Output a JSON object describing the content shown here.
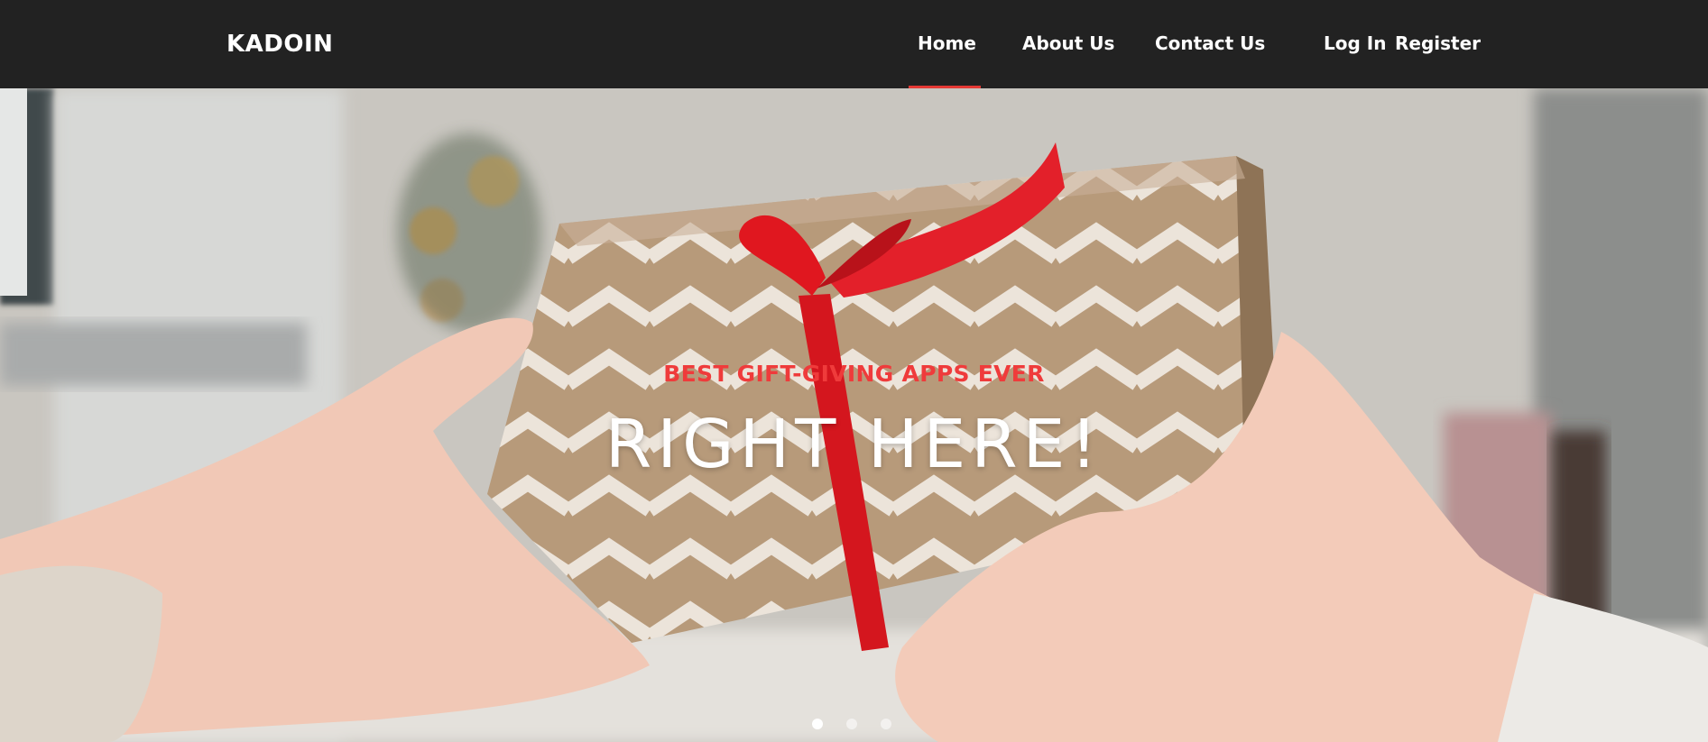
{
  "brand": {
    "name": "KADOIN"
  },
  "nav": {
    "home": "Home",
    "about": "About Us",
    "contact": "Contact Us",
    "login": "Log In",
    "register": "Register",
    "active": "Home"
  },
  "hero": {
    "kicker": "BEST GIFT-GIVING APPS EVER",
    "title": "RIGHT HERE!",
    "image": "gift-box-exchange-photo",
    "slide_count": 3,
    "active_slide": 1
  },
  "colors": {
    "navbar_bg": "#222222",
    "accent": "#e53935",
    "kicker": "#ef3b3b",
    "text": "#ffffff"
  }
}
